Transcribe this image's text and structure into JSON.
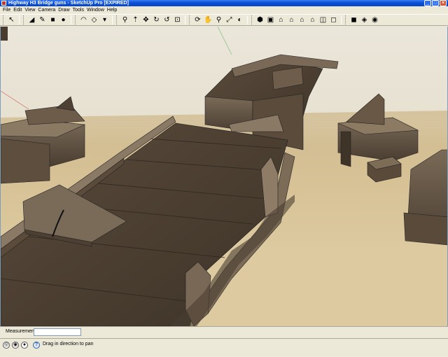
{
  "window": {
    "title": "Highway H3 Bridge guns - SketchUp Pro [EXPIRED]",
    "controls": {
      "minimize": "_",
      "maximize": "□",
      "close": "×"
    }
  },
  "menu": [
    "File",
    "Edit",
    "View",
    "Camera",
    "Draw",
    "Tools",
    "Window",
    "Help"
  ],
  "toolbar": {
    "tools": [
      {
        "name": "select-tool-icon",
        "glyph": "↖"
      },
      {
        "name": "eraser-icon",
        "glyph": "◢"
      },
      {
        "name": "pencil-line-icon",
        "glyph": "✎"
      },
      {
        "name": "rectangle-icon",
        "glyph": "■"
      },
      {
        "name": "circle-icon",
        "glyph": "●"
      },
      {
        "name": "arc-icon",
        "glyph": "◠"
      },
      {
        "name": "make-component-icon",
        "glyph": "◇"
      },
      {
        "name": "paint-bucket-icon",
        "glyph": "▾"
      },
      {
        "name": "tape-measure-icon",
        "glyph": "⚲"
      },
      {
        "name": "push-pull-icon",
        "glyph": "⇡"
      },
      {
        "name": "move-icon",
        "glyph": "✥"
      },
      {
        "name": "rotate-icon",
        "glyph": "↻"
      },
      {
        "name": "follow-me-icon",
        "glyph": "↺"
      },
      {
        "name": "offset-icon",
        "glyph": "⊡"
      },
      {
        "name": "orbit-icon",
        "glyph": "⟳"
      },
      {
        "name": "pan-icon",
        "glyph": "✋"
      },
      {
        "name": "zoom-icon",
        "glyph": "⚲"
      },
      {
        "name": "zoom-extents-icon",
        "glyph": "⤢"
      },
      {
        "name": "previous-view-icon",
        "glyph": "◐"
      },
      {
        "name": "iso-view-icon",
        "glyph": "⬢"
      },
      {
        "name": "top-view-icon",
        "glyph": "▣"
      },
      {
        "name": "front-view-icon",
        "glyph": "⌂"
      },
      {
        "name": "right-view-icon",
        "glyph": "⌂"
      },
      {
        "name": "back-view-icon",
        "glyph": "⌂"
      },
      {
        "name": "left-view-icon",
        "glyph": "⌂"
      },
      {
        "name": "xray-icon",
        "glyph": "◫"
      },
      {
        "name": "wireframe-icon",
        "glyph": "◻"
      },
      {
        "name": "hidden-line-icon",
        "glyph": "◼"
      },
      {
        "name": "shaded-icon",
        "glyph": "◈"
      },
      {
        "name": "shaded-textures-icon",
        "glyph": "◉"
      }
    ]
  },
  "viewport": {
    "description_colors": {
      "sky": "#e9e4d8",
      "ground": "#d9c397",
      "wood_dark": "#4a3d30",
      "wood_mid": "#6b5a46",
      "wood_light": "#8a7560"
    }
  },
  "status": {
    "measurements_label": "Measurements",
    "measurements_value": "",
    "hint": "Drag in direction to pan",
    "icons": [
      {
        "name": "geo-location-icon",
        "glyph": "◎"
      },
      {
        "name": "credits-icon",
        "glyph": "◉"
      },
      {
        "name": "user-icon",
        "glyph": "●"
      },
      {
        "name": "help-icon",
        "glyph": "?"
      }
    ]
  }
}
